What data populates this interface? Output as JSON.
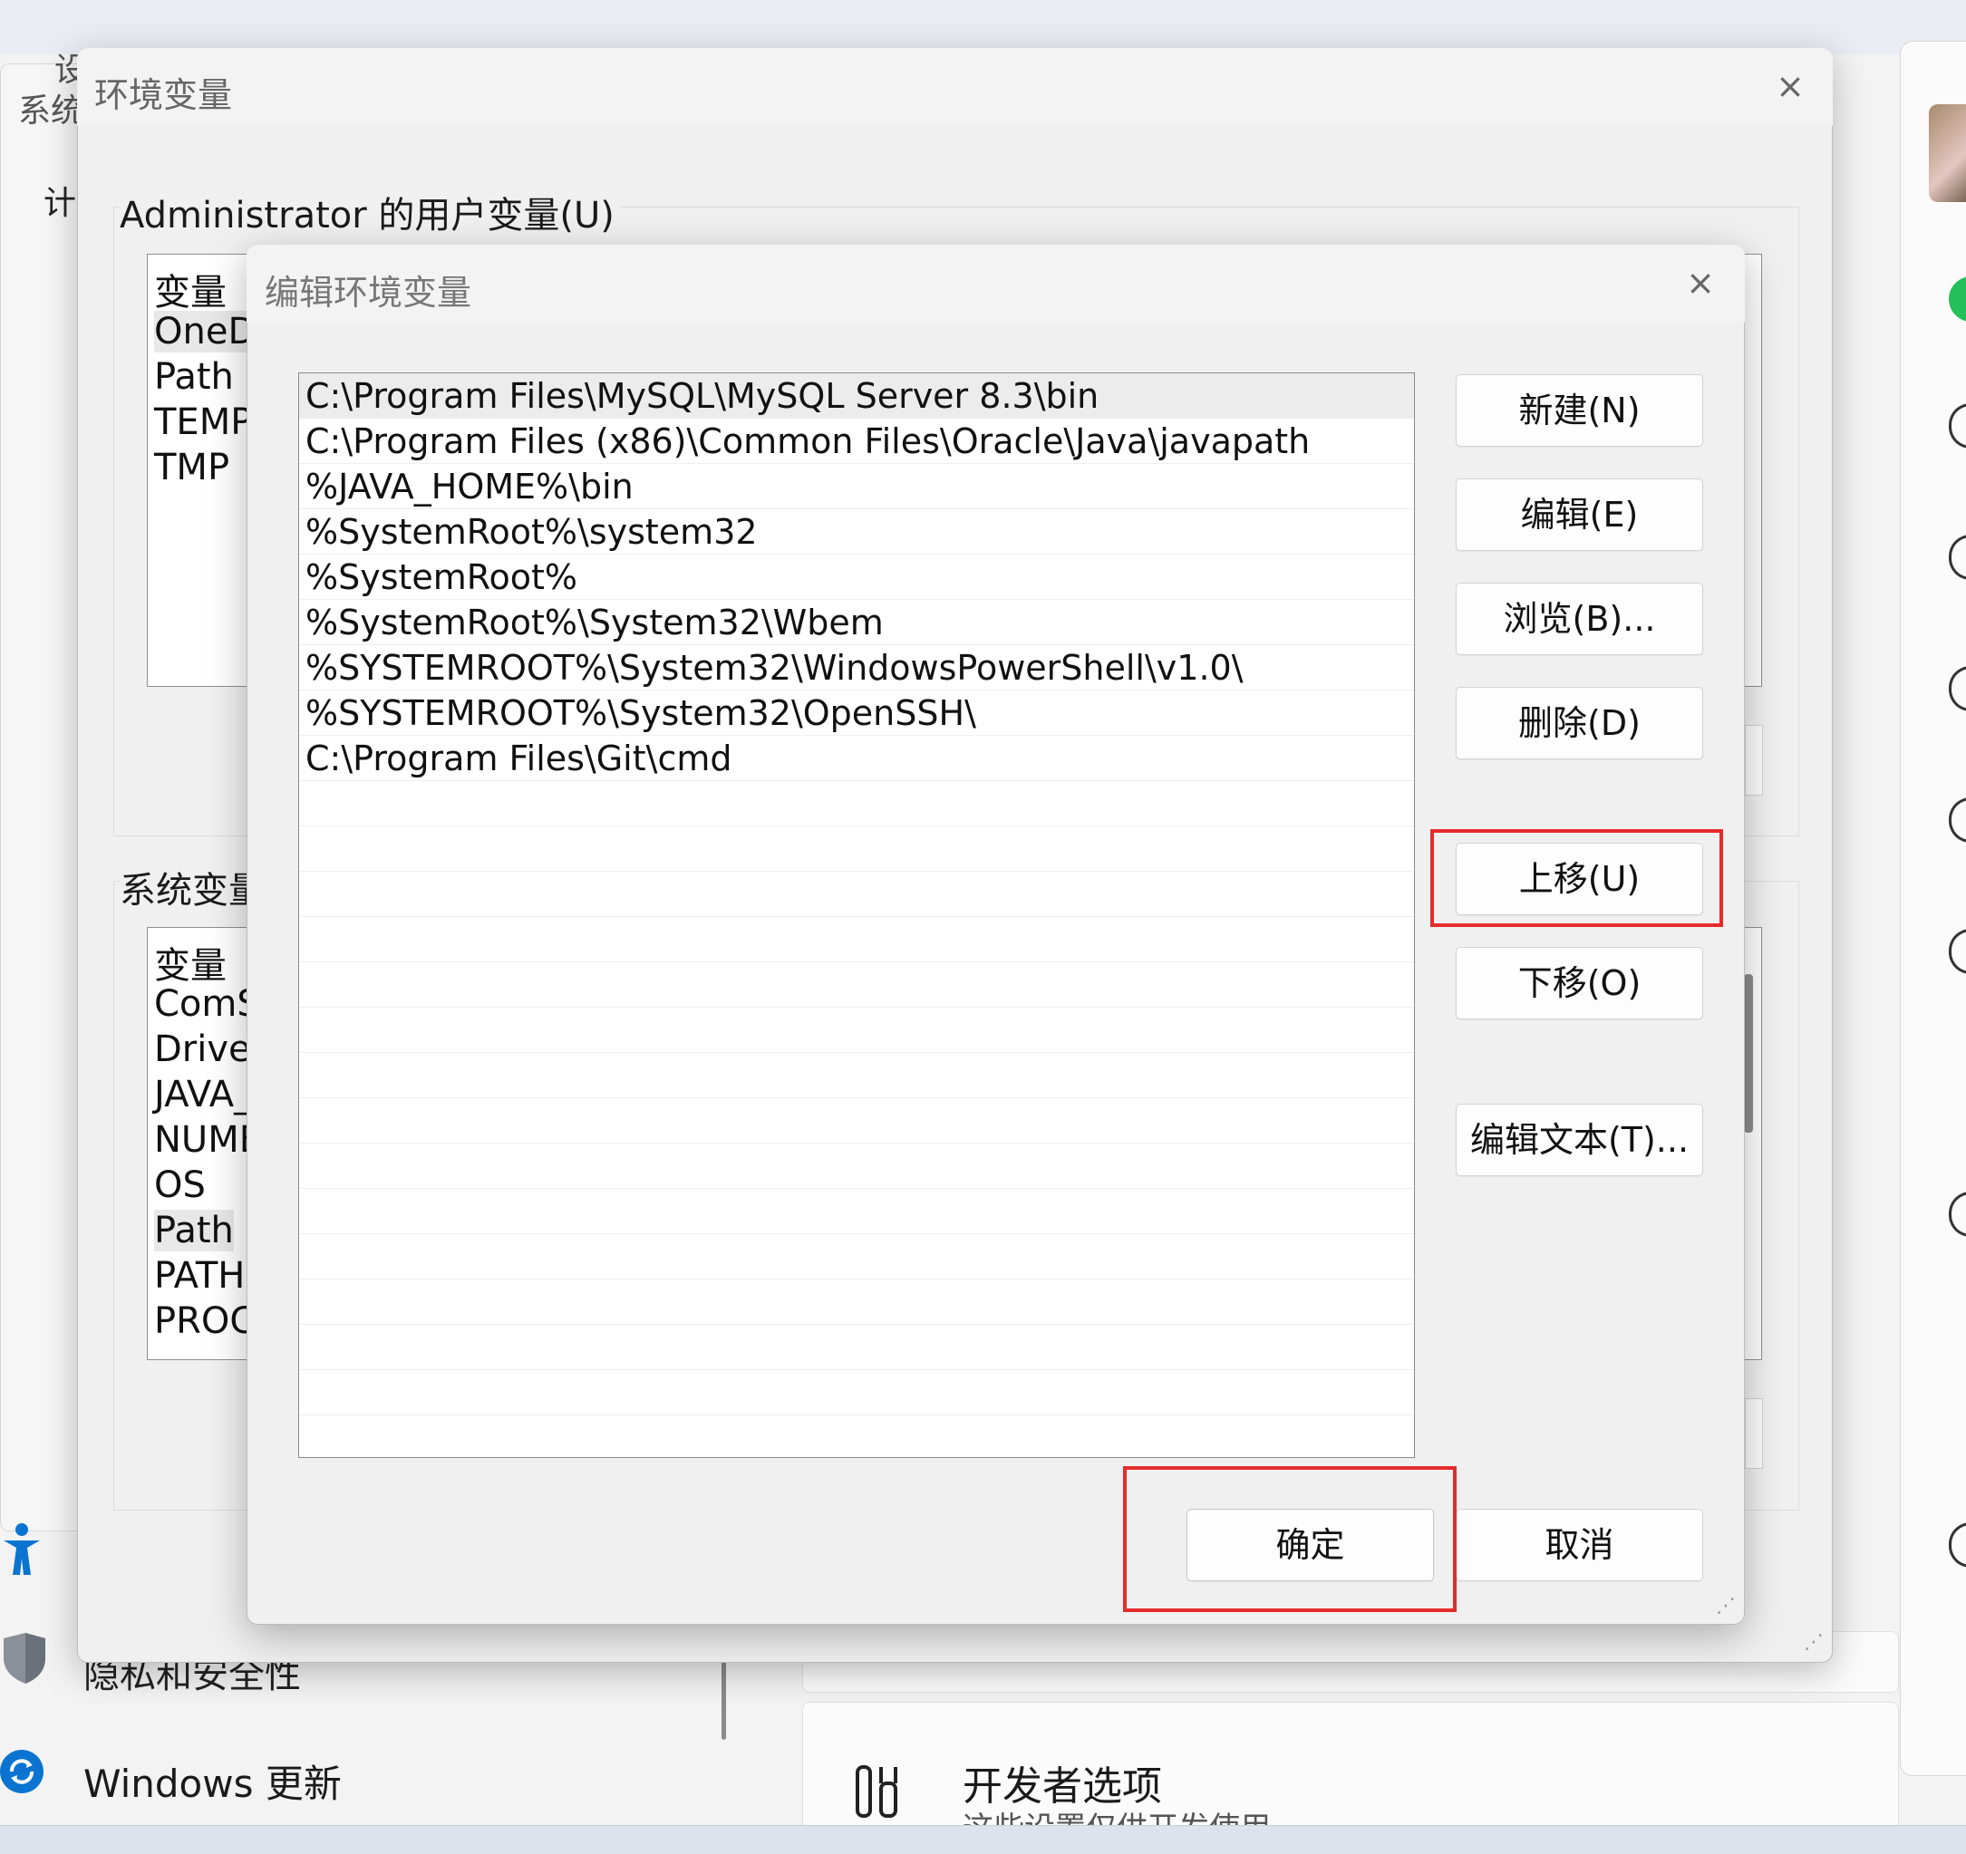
{
  "background": {
    "partial_labels": [
      "设",
      "系统",
      "计"
    ],
    "nav": {
      "privacy_label": "隐私和安全性",
      "update_label": "Windows 更新"
    },
    "developer_card": {
      "title": "开发者选项",
      "subtitle": "这些设置仅供开发使用"
    }
  },
  "env_dialog": {
    "title": "环境变量",
    "close_glyph": "×",
    "user_group_label": "Administrator 的用户变量(U)",
    "user_vars_header": "变量",
    "user_vars": [
      "OneDr",
      "Path",
      "TEMP",
      "TMP"
    ],
    "system_group_label": "系统变量",
    "system_vars_header": "变量",
    "system_vars": [
      "ComS",
      "Driver",
      "JAVA_",
      "NUME",
      "OS",
      "Path",
      "PATHE",
      "PROC"
    ]
  },
  "edit_dialog": {
    "title": "编辑环境变量",
    "close_glyph": "×",
    "paths": [
      "C:\\Program Files\\MySQL\\MySQL Server 8.3\\bin",
      "C:\\Program Files (x86)\\Common Files\\Oracle\\Java\\javapath",
      "%JAVA_HOME%\\bin",
      "%SystemRoot%\\system32",
      "%SystemRoot%",
      "%SystemRoot%\\System32\\Wbem",
      "%SYSTEMROOT%\\System32\\WindowsPowerShell\\v1.0\\",
      "%SYSTEMROOT%\\System32\\OpenSSH\\",
      "C:\\Program Files\\Git\\cmd"
    ],
    "selected_index": 0,
    "buttons": {
      "new": "新建(N)",
      "edit": "编辑(E)",
      "browse": "浏览(B)...",
      "delete": "删除(D)",
      "move_up": "上移(U)",
      "move_down": "下移(O)",
      "edit_text": "编辑文本(T)...",
      "ok": "确定",
      "cancel": "取消"
    }
  },
  "colors": {
    "highlight": "#e52b2b",
    "dialog_bg": "#f0f0f0",
    "selected_row": "#ececec"
  }
}
